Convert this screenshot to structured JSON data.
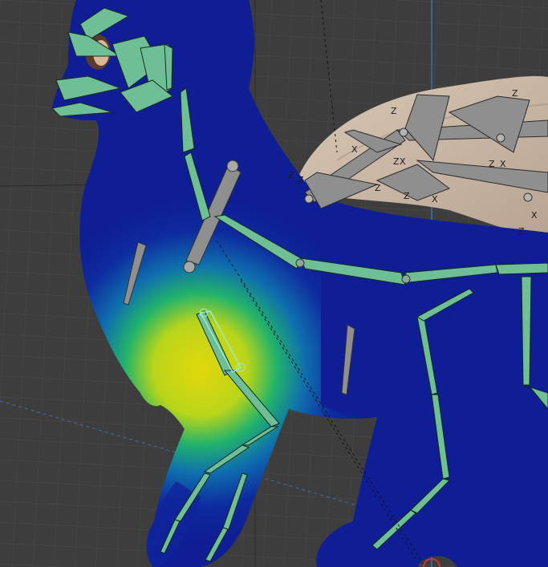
{
  "viewport": {
    "mode": "weight-paint",
    "colors": {
      "background": "#3d3d3d",
      "grid": "#4a4a4a",
      "grid_major": "#2f2f2f",
      "axis_blue": "#3d6fb0",
      "mesh_blue": "#0f1e94",
      "weight_green": "#22b36a",
      "weight_yellow": "#d9d60f",
      "wing_membrane": "#cbb8a6",
      "bone_green": "#6fbf96",
      "bone_gray": "#8f8f8f",
      "bone_selected": "#9fe8c8"
    }
  },
  "wing_axis_labels": [
    "Z",
    "Z",
    "Z",
    "X",
    "Z",
    "X",
    "Z",
    "X",
    "Z",
    "X",
    "Z",
    "X",
    "Z",
    "Z"
  ],
  "icons": {
    "bone": "bone-icon",
    "object_origin": "object-origin-icon"
  }
}
